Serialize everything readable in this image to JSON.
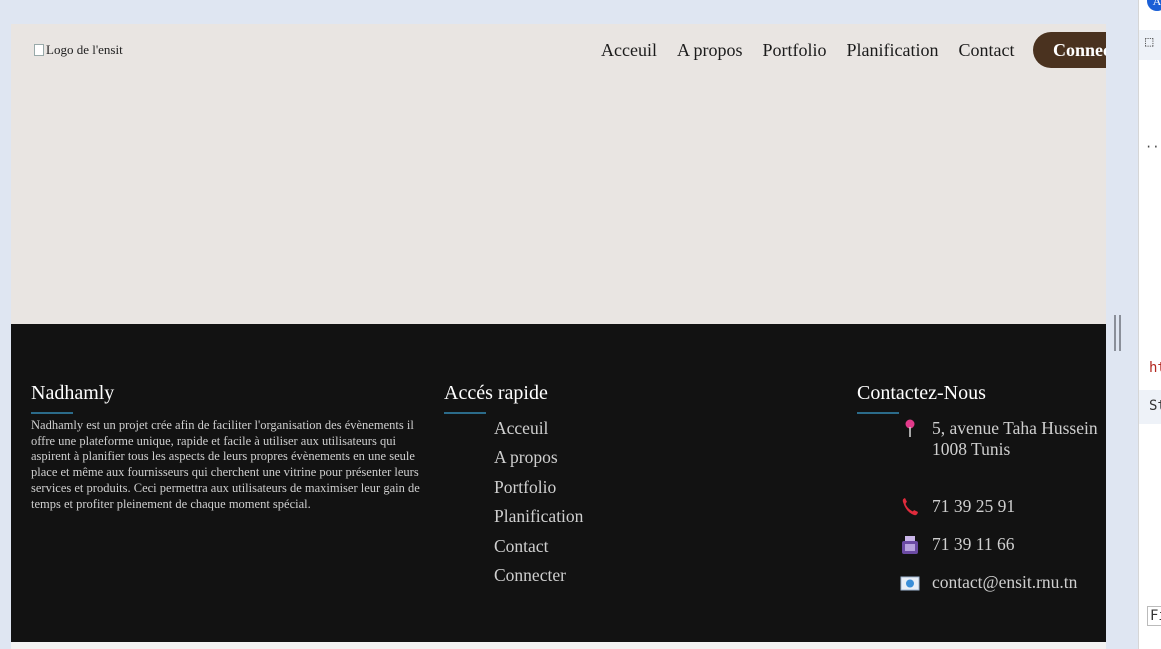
{
  "header": {
    "logo_alt": "Logo de l'ensit",
    "nav": [
      "Acceuil",
      "A propos",
      "Portfolio",
      "Planification",
      "Contact"
    ],
    "connect_label": "Connecter"
  },
  "footer": {
    "about": {
      "title": "Nadhamly",
      "text": "Nadhamly est un projet crée afin de faciliter l'organisation des évènements il offre une plateforme unique, rapide et facile à utiliser aux utilisateurs qui aspirent à planifier tous les aspects de leurs propres évènements en une seule place et même aux fournisseurs qui cherchent une vitrine pour présenter leurs services et produits. Ceci permettra aux utilisateurs de maximiser leur gain de temps et profiter pleinement de chaque moment spécial."
    },
    "quick": {
      "title": "Accés rapide",
      "links": [
        "Acceuil",
        "A propos",
        "Portfolio",
        "Planification",
        "Contact",
        "Connecter"
      ]
    },
    "contact": {
      "title": "Contactez-Nous",
      "address_line1": "5, avenue Taha Hussein",
      "address_line2": "1008 Tunis",
      "phone": "71 39 25 91",
      "fax": "71 39 11 66",
      "email": "contact@ensit.rnu.tn"
    }
  },
  "devtools": {
    "frag_ht": "ht",
    "frag_st": "St",
    "frag_fi": "Fi",
    "dots": "···"
  },
  "colors": {
    "header_bg": "#e9e5e2",
    "footer_bg": "#121212",
    "button_bg": "#4a321f",
    "underline": "#2b6b8a"
  }
}
